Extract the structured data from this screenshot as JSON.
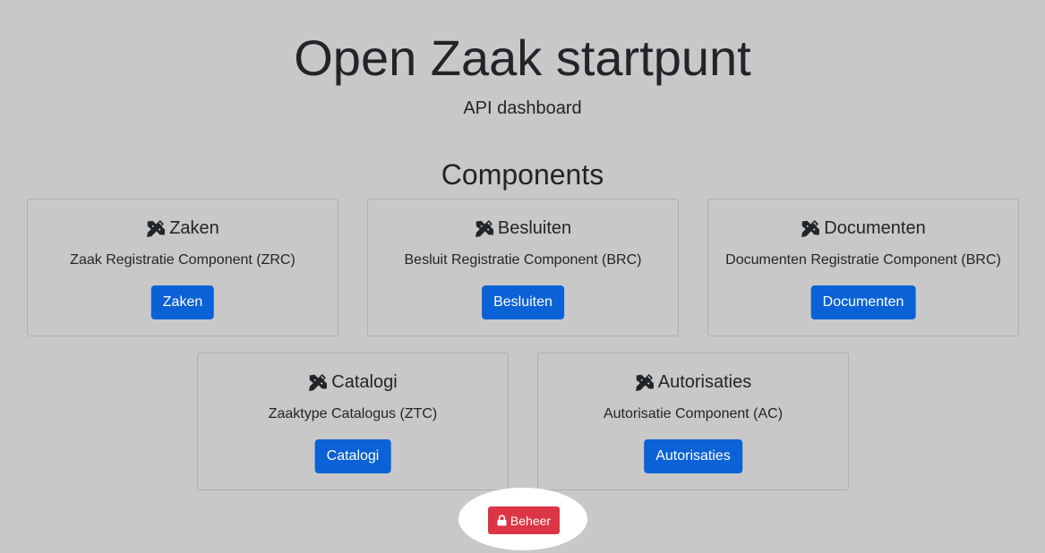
{
  "header": {
    "title": "Open Zaak startpunt",
    "subtitle": "API dashboard"
  },
  "components": {
    "heading": "Components",
    "items": [
      {
        "title": "Zaken",
        "description": "Zaak Registratie Component (ZRC)",
        "button_label": "Zaken",
        "icon": "pencil-ruler-icon"
      },
      {
        "title": "Besluiten",
        "description": "Besluit Registratie Component (BRC)",
        "button_label": "Besluiten",
        "icon": "pencil-ruler-icon"
      },
      {
        "title": "Documenten",
        "description": "Documenten Registratie Component (BRC)",
        "button_label": "Documenten",
        "icon": "pencil-ruler-icon"
      },
      {
        "title": "Catalogi",
        "description": "Zaaktype Catalogus (ZTC)",
        "button_label": "Catalogi",
        "icon": "pencil-ruler-icon"
      },
      {
        "title": "Autorisaties",
        "description": "Autorisatie Component (AC)",
        "button_label": "Autorisaties",
        "icon": "pencil-ruler-icon"
      }
    ]
  },
  "admin": {
    "button_label": "Beheer",
    "icon": "lock-icon"
  },
  "colors": {
    "background": "#c8c8c8",
    "primary": "#0b61d6",
    "danger": "#dc3545",
    "text": "#212529"
  }
}
